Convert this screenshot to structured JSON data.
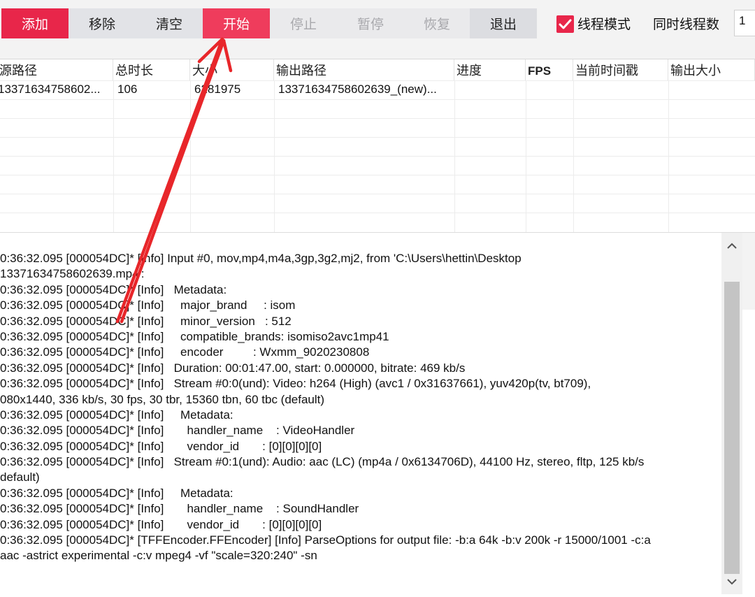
{
  "toolbar": {
    "add": "添加",
    "remove": "移除",
    "clear": "清空",
    "start": "开始",
    "stop": "停止",
    "pause": "暂停",
    "resume": "恢复",
    "exit": "退出",
    "thread_mode_label": "线程模式",
    "thread_mode_checked": true,
    "thread_count_label": "同时线程数",
    "thread_count_value": "1"
  },
  "table": {
    "columns": [
      "源路径",
      "总时长",
      "大小",
      "输出路径",
      "进度",
      "FPS",
      "当前时间戳",
      "输出大小"
    ],
    "rows": [
      [
        "13371634758602...",
        "106",
        "6281975",
        "13371634758602639_(new)...",
        "",
        "",
        "",
        ""
      ]
    ]
  },
  "log": {
    "lines": [
      "0:36:32.095 [000054DC]* [Info] Input #0, mov,mp4,m4a,3gp,3g2,mj2, from 'C:\\Users\\hettin\\Desktop",
      "13371634758602639.mp4':",
      "0:36:32.095 [000054DC]* [Info]   Metadata:",
      "0:36:32.095 [000054DC]* [Info]     major_brand     : isom",
      "0:36:32.095 [000054DC]* [Info]     minor_version   : 512",
      "0:36:32.095 [000054DC]* [Info]     compatible_brands: isomiso2avc1mp41",
      "0:36:32.095 [000054DC]* [Info]     encoder         : Wxmm_9020230808",
      "0:36:32.095 [000054DC]* [Info]   Duration: 00:01:47.00, start: 0.000000, bitrate: 469 kb/s",
      "0:36:32.095 [000054DC]* [Info]   Stream #0:0(und): Video: h264 (High) (avc1 / 0x31637661), yuv420p(tv, bt709),",
      "080x1440, 336 kb/s, 30 fps, 30 tbr, 15360 tbn, 60 tbc (default)",
      "0:36:32.095 [000054DC]* [Info]     Metadata:",
      "0:36:32.095 [000054DC]* [Info]       handler_name    : VideoHandler",
      "0:36:32.095 [000054DC]* [Info]       vendor_id       : [0][0][0][0]",
      "0:36:32.095 [000054DC]* [Info]   Stream #0:1(und): Audio: aac (LC) (mp4a / 0x6134706D), 44100 Hz, stereo, fltp, 125 kb/s",
      "default)",
      "0:36:32.095 [000054DC]* [Info]     Metadata:",
      "0:36:32.095 [000054DC]* [Info]       handler_name    : SoundHandler",
      "0:36:32.095 [000054DC]* [Info]       vendor_id       : [0][0][0][0]",
      "0:36:32.095 [000054DC]* [TFFEncoder.FFEncoder] [Info] ParseOptions for output file: -b:a 64k -b:v 200k -r 15000/1001 -c:a",
      "aac -astrict experimental -c:v mpeg4 -vf \"scale=320:240\" -sn"
    ]
  },
  "colors": {
    "accent_red": "#e8264a",
    "arrow_red": "#e8262a"
  }
}
